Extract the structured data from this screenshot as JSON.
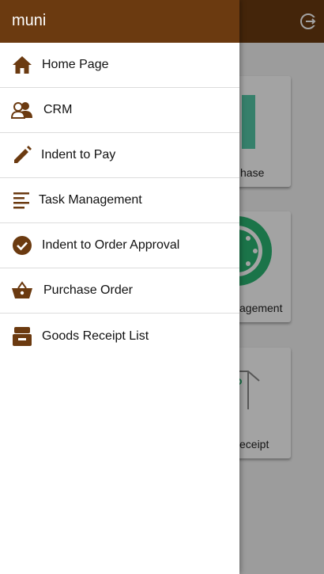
{
  "drawer": {
    "title": "muni",
    "items": [
      {
        "label": "Home Page",
        "icon": "home-icon"
      },
      {
        "label": "CRM",
        "icon": "users-icon"
      },
      {
        "label": "Indent to Pay",
        "icon": "pencil-icon"
      },
      {
        "label": "Task Management",
        "icon": "list-icon"
      },
      {
        "label": "Indent to Order Approval",
        "icon": "check-circle-icon"
      },
      {
        "label": "Purchase Order",
        "icon": "basket-icon"
      },
      {
        "label": "Goods Receipt List",
        "icon": "archive-box-icon"
      }
    ]
  },
  "background": {
    "cards": [
      {
        "label": "hase"
      },
      {
        "label": "agement"
      },
      {
        "label": "eceipt"
      }
    ]
  },
  "colors": {
    "primary": "#6b3a10",
    "icon": "#6b3a10",
    "accent_green": "#2bb673"
  }
}
